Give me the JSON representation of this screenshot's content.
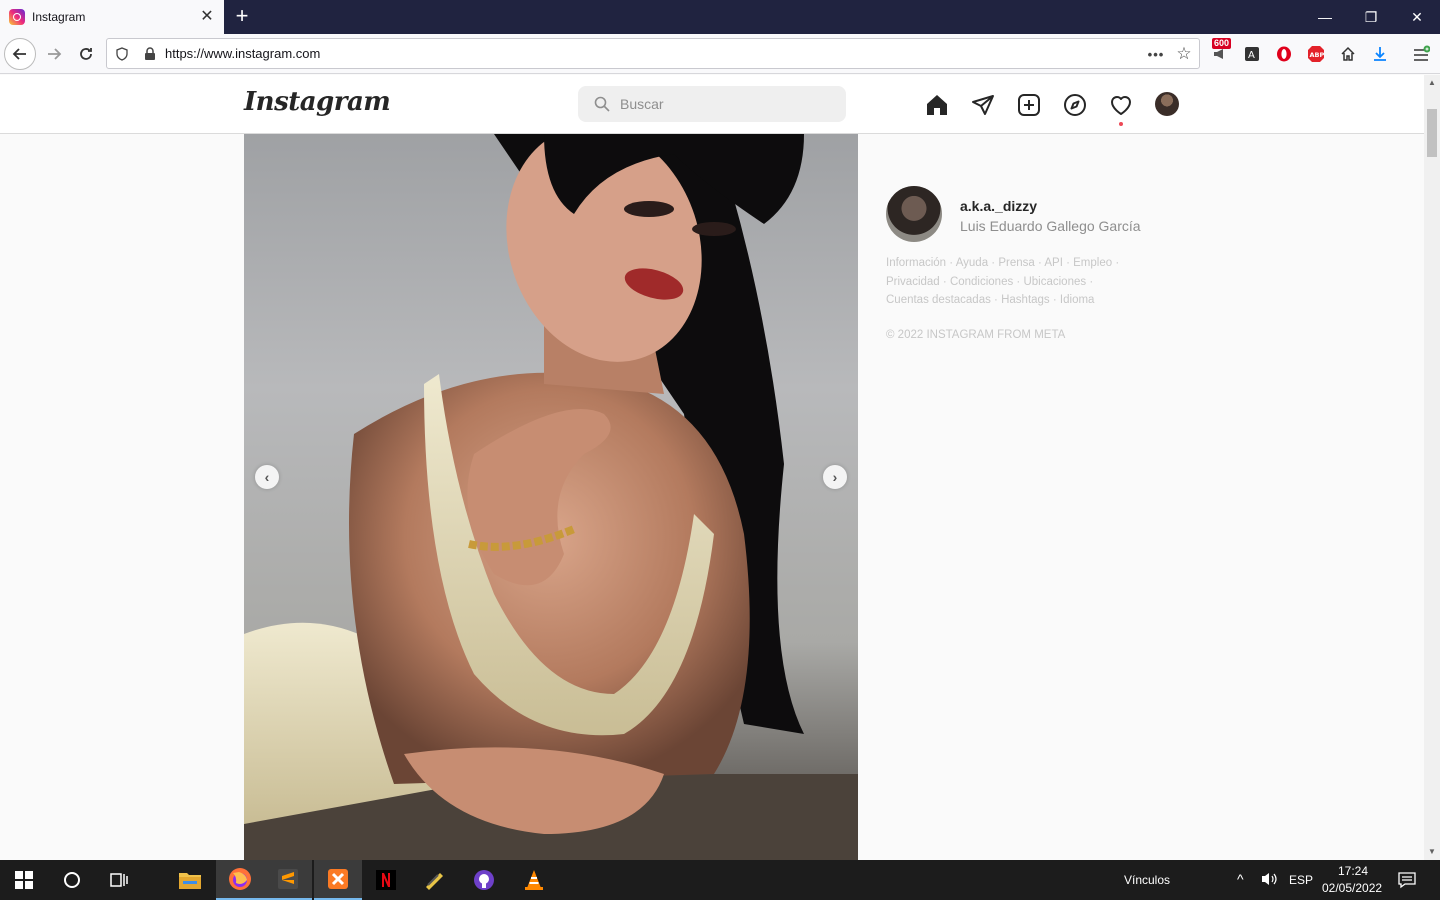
{
  "browser": {
    "tab_title": "Instagram",
    "url": "https://www.instagram.com",
    "extension_badge": "600"
  },
  "instagram": {
    "logo": "Instagram",
    "search_placeholder": "Buscar"
  },
  "profile": {
    "username": "a.k.a._dizzy",
    "full_name": "Luis Eduardo Gallego García"
  },
  "footer": {
    "links": [
      "Información",
      "Ayuda",
      "Prensa",
      "API",
      "Empleo",
      "Privacidad",
      "Condiciones",
      "Ubicaciones",
      "Cuentas destacadas",
      "Hashtags",
      "Idioma"
    ],
    "copyright": "© 2022 INSTAGRAM FROM META"
  },
  "taskbar": {
    "toolbar_label": "Vínculos",
    "language": "ESP",
    "time": "17:24",
    "date": "02/05/2022"
  },
  "colors": {
    "tab_strip": "#202340",
    "notification_dot": "#ed4956",
    "taskbar": "#1c1c1c"
  }
}
